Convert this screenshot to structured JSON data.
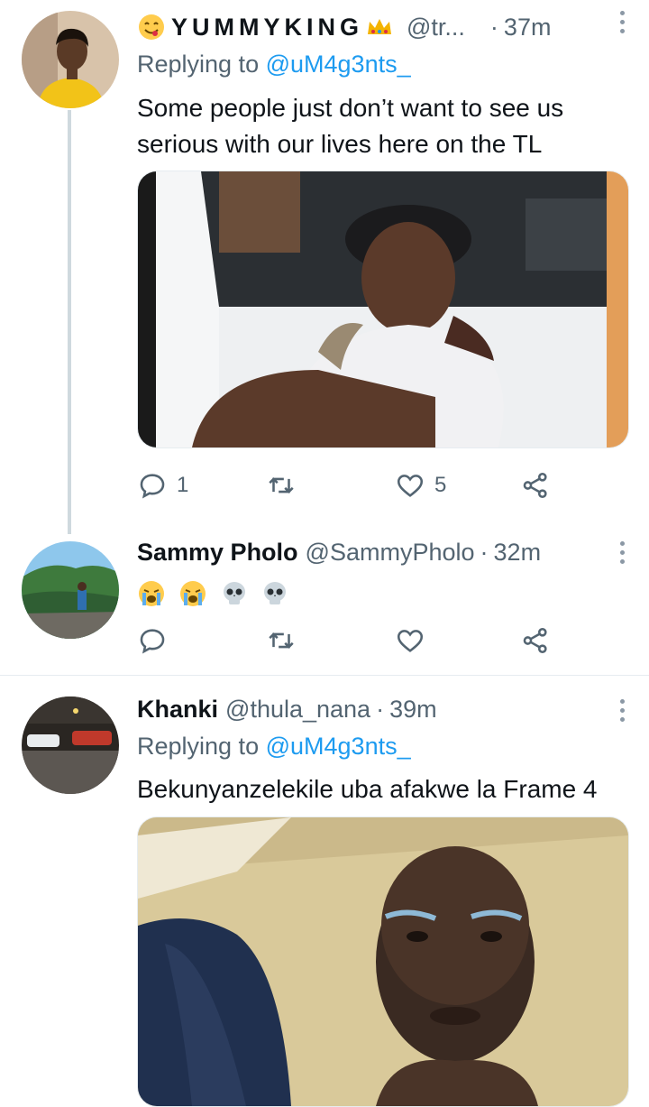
{
  "tweets": [
    {
      "name": "YUMMYKING",
      "handle": "@tr...",
      "dot": "·",
      "time": "37m",
      "replying_label": "Replying to",
      "replying_to": "@uM4g3nts_",
      "text": "Some people just don’t want to see us serious with our lives here on the TL",
      "reply_count": "1",
      "retweet_count": "",
      "like_count": "5",
      "avatar_colors": [
        "#d9c2a6",
        "#f5c518"
      ]
    },
    {
      "name": "Sammy Pholo",
      "handle": "@SammyPholo",
      "dot": "·",
      "time": "32m",
      "emoji_text": [
        "crying-face",
        "crying-face",
        "skull",
        "skull"
      ],
      "reply_count": "",
      "retweet_count": "",
      "like_count": ""
    },
    {
      "name": "Khanki",
      "handle": "@thula_nana",
      "dot": "·",
      "time": "39m",
      "replying_label": "Replying to",
      "replying_to": "@uM4g3nts_",
      "text": "Bekunyanzelekile uba afakwe la Frame 4"
    }
  ],
  "icons": [
    "face-savoring-emoji",
    "crown-emoji",
    "reply-icon",
    "retweet-icon",
    "like-icon",
    "share-icon",
    "more-icon"
  ],
  "colors": {
    "link": "#1d9bf0",
    "secondary": "#536471",
    "divider": "#e6ecf0",
    "thread_line": "#cfd9de"
  }
}
